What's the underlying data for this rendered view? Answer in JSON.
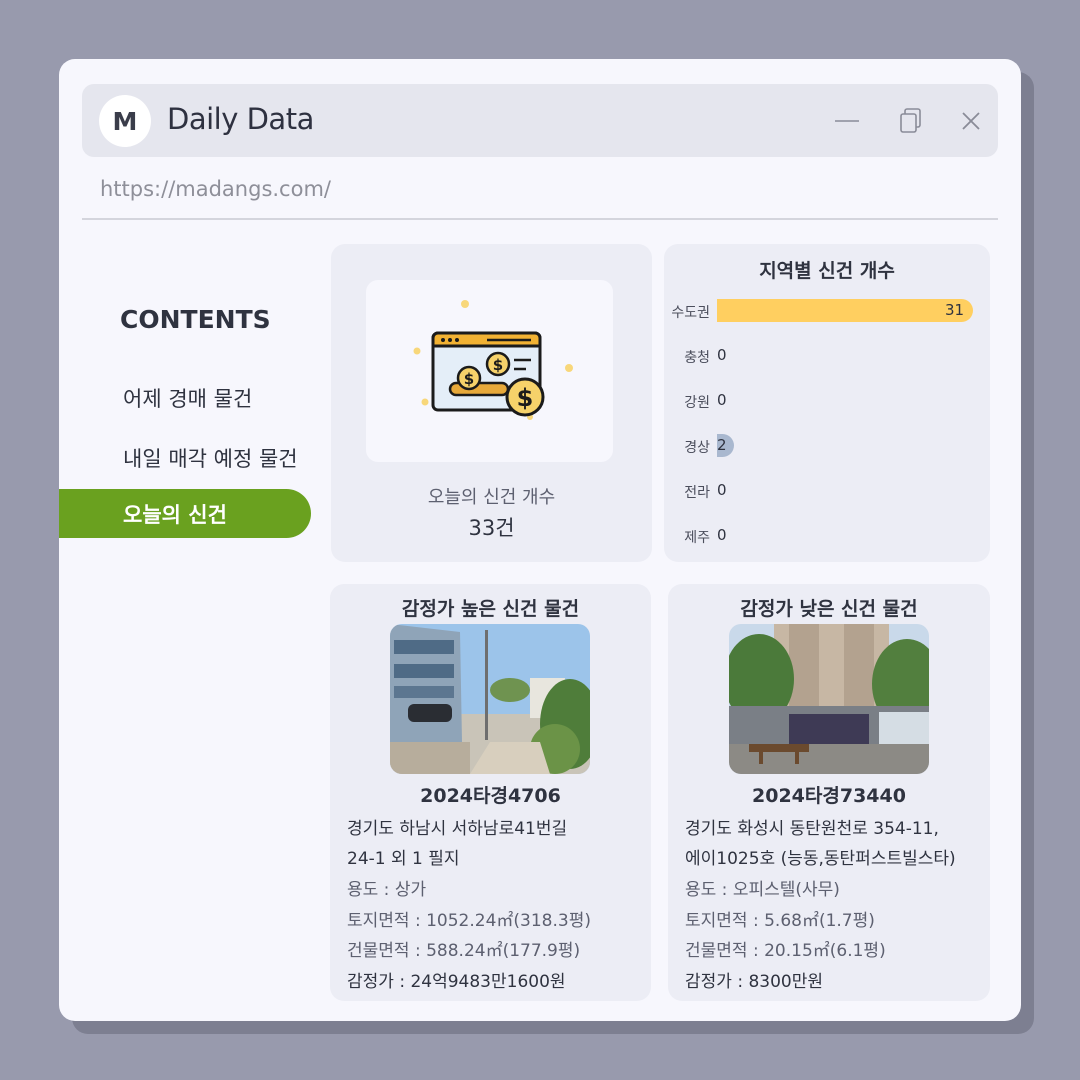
{
  "app": {
    "avatar_letter": "M",
    "title": "Daily Data",
    "url": "https://madangs.com/"
  },
  "sidebar": {
    "title": "CONTENTS",
    "items": [
      {
        "label": "어제 경매 물건",
        "active": false
      },
      {
        "label": "내일 매각 예정 물건",
        "active": false
      },
      {
        "label": "오늘의 신건",
        "active": true
      }
    ]
  },
  "today_count": {
    "label": "오늘의 신건 개수",
    "value": "33건"
  },
  "regions": {
    "title": "지역별 신건 개수",
    "items": [
      {
        "name": "수도권",
        "value": 31,
        "color": "#ffcf60"
      },
      {
        "name": "충청",
        "value": 0,
        "color": "#ffcf60"
      },
      {
        "name": "강원",
        "value": 0,
        "color": "#ffcf60"
      },
      {
        "name": "경상",
        "value": 2,
        "color": "#a9b8cf"
      },
      {
        "name": "전라",
        "value": 0,
        "color": "#ffcf60"
      },
      {
        "name": "제주",
        "value": 0,
        "color": "#ffcf60"
      }
    ]
  },
  "high_item": {
    "title": "감정가 높은 신건 물건",
    "case_no": "2024타경4706",
    "address_line1": "경기도 하남시 서하남로41번길",
    "address_line2": "24-1 외 1 필지",
    "usage": "용도 :  상가",
    "land_area": "토지면적 : 1052.24㎡(318.3평)",
    "building_area": "건물면적 : 588.24㎡(177.9평)",
    "appraisal": "감정가 : 24억9483만1600원"
  },
  "low_item": {
    "title": "감정가 낮은 신건 물건",
    "case_no": "2024타경73440",
    "address_line1": "경기도 화성시 동탄원천로 354-11,",
    "address_line2": "에이1025호 (능동,동탄퍼스트빌스타)",
    "usage": "용도 : 오피스텔(사무)",
    "land_area": "토지면적 : 5.68㎡(1.7평)",
    "building_area": "건물면적 : 20.15㎡(6.1평)",
    "appraisal": "감정가 : 8300만원"
  },
  "colors": {
    "accent_green": "#6aa11f",
    "bar_yellow": "#ffcf60",
    "bar_blue": "#a9b8cf"
  }
}
